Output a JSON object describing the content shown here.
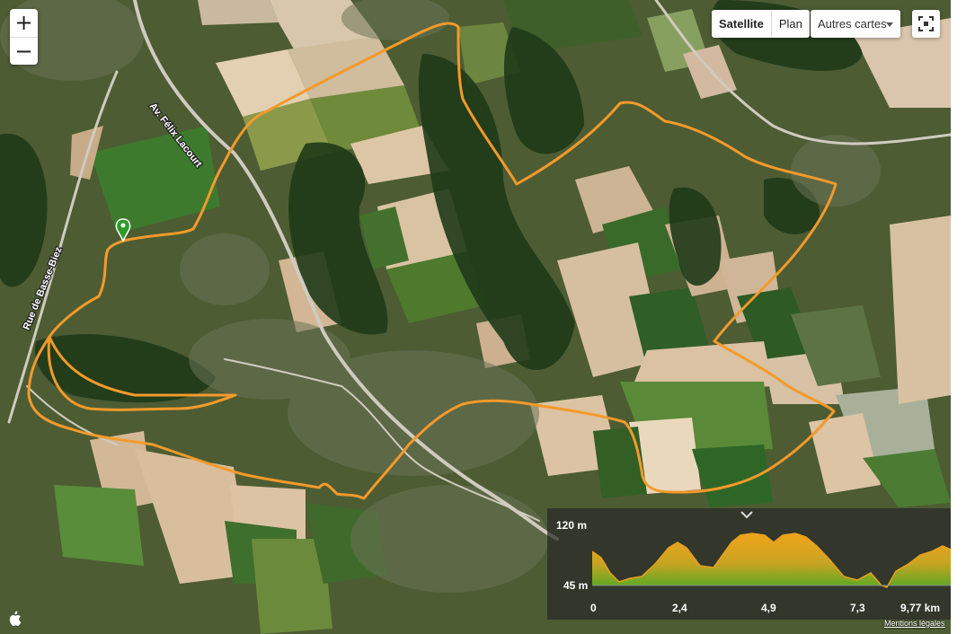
{
  "controls": {
    "zoom_in": "+",
    "zoom_out": "−",
    "map_types": [
      "Satellite",
      "Plan"
    ],
    "active_map_type": "Satellite",
    "other_maps": "Autres cartes",
    "fullscreen_icon": "fullscreen-icon"
  },
  "roads": [
    {
      "name": "Av. Félix Lacourt"
    },
    {
      "name": "Rue de Basse-Biez"
    },
    {
      "name": "Av. Félix Lacourt"
    }
  ],
  "route": {
    "color": "#f39a2b",
    "start_marker_color": "#2e9b2a"
  },
  "elevation": {
    "y_max": "120 m",
    "y_min": "45 m",
    "x_ticks": [
      "0",
      "2,4",
      "4,9",
      "7,3",
      "9,77 km"
    ],
    "profile_color": "#f0a41c",
    "profile_color_low": "#5aa824"
  },
  "footer": {
    "legal": "Mentions légales",
    "apple_icon": "apple-logo-icon"
  }
}
